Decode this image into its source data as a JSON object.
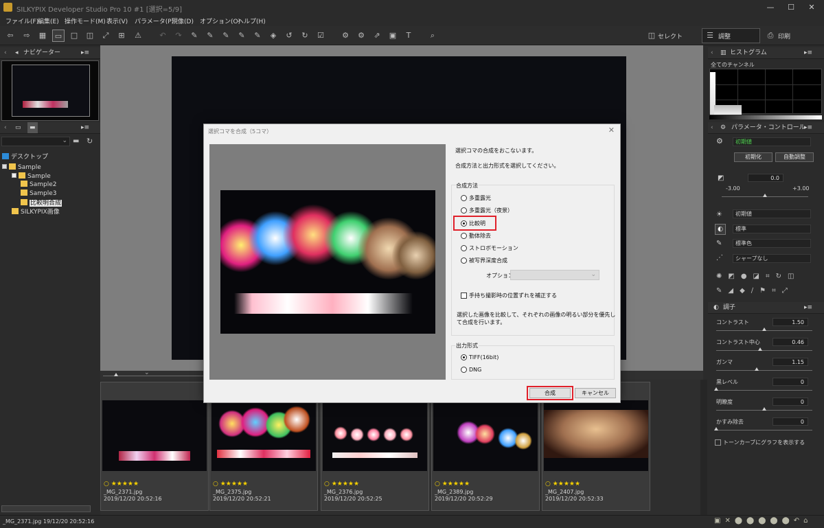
{
  "window": {
    "title": "SILKYPIX Developer Studio Pro 10   #1   [選択=5/9]",
    "minimize": "—",
    "maximize": "☐",
    "close": "✕"
  },
  "menu": [
    "ファイル(F)",
    "編集(E)",
    "操作モード(M)",
    "表示(V)",
    "パラメータ(P)",
    "現像(D)",
    "オプション(O)",
    "ヘルプ(H)"
  ],
  "toolbar": {
    "select_label": "セレクト",
    "adjust_label": "調整",
    "print_label": "印刷"
  },
  "navigator": {
    "title": "ナビゲーター"
  },
  "folder_panel": {
    "tree": [
      {
        "label": "デスクトップ"
      },
      {
        "label": "Sample"
      },
      {
        "label": "Sample"
      },
      {
        "label": "Sample2"
      },
      {
        "label": "Sample3"
      },
      {
        "label": "比較明合成"
      },
      {
        "label": "SILKYPIX画像"
      }
    ]
  },
  "thumbnails": [
    {
      "name": "_MG_2371.jpg",
      "date": "2019/12/20 20:52:16",
      "stars": "○ ★★★★★"
    },
    {
      "name": "_MG_2375.jpg",
      "date": "2019/12/20 20:52:21",
      "stars": "○ ★★★★★"
    },
    {
      "name": "_MG_2376.jpg",
      "date": "2019/12/20 20:52:25",
      "stars": "○ ★★★★★"
    },
    {
      "name": "_MG_2389.jpg",
      "date": "2019/12/20 20:52:29",
      "stars": "○ ★★★★★"
    },
    {
      "name": "_MG_2407.jpg",
      "date": "2019/12/20 20:52:33",
      "stars": "○ ★★★★★"
    }
  ],
  "histogram": {
    "title": "ヒストグラム",
    "channel": "全てのチャンネル"
  },
  "param_control": {
    "title": "パラメータ・コントロール",
    "preset": "初期値",
    "reset_button": "初期化",
    "auto_button": "自動調整",
    "exposure_value": "0.0",
    "exposure_min": "-3.00",
    "exposure_max": "+3.00",
    "wb_select": "初期値",
    "tone_select": "標準",
    "color_select": "標準色",
    "sharp_select": "シャープなし"
  },
  "tone_panel": {
    "title": "調子",
    "rows": [
      {
        "label": "コントラスト",
        "value": "1.50",
        "pos": 0.5
      },
      {
        "label": "コントラスト中心",
        "value": "0.46",
        "pos": 0.46
      },
      {
        "label": "ガンマ",
        "value": "1.15",
        "pos": 0.42
      },
      {
        "label": "黒レベル",
        "value": "0",
        "pos": 0.0
      },
      {
        "label": "明瞭度",
        "value": "0",
        "pos": 0.5
      },
      {
        "label": "かすみ除去",
        "value": "0",
        "pos": 0.0
      }
    ],
    "curve_checkbox": "トーンカーブにグラフを表示する"
  },
  "status": {
    "text": "_MG_2371.jpg 19/12/20 20:52:16"
  },
  "dialog": {
    "title": "選択コマを合成（5コマ）",
    "close": "✕",
    "desc1": "選択コマの合成をおこないます。",
    "desc2": "合成方法と出力形式を選択してください。",
    "method_group": "合成方法",
    "methods": [
      "多重露光",
      "多重露光（夜景）",
      "比較明",
      "動体除去",
      "ストロボモーション",
      "被写界深度合成"
    ],
    "selected_method": "比較明",
    "option_label": "オプション",
    "handheld_label": "手持ち撮影時の位置ずれを補正する",
    "explain1": "選択した画像を比較して、それぞれの画像の明るい部分を優先し",
    "explain2": "て合成を行います。",
    "output_group": "出力形式",
    "outputs": [
      "TIFF(16bit)",
      "DNG"
    ],
    "selected_output": "TIFF(16bit)",
    "ok_button": "合成",
    "cancel_button": "キャンセル"
  },
  "colors": {
    "highlight_red": "#e0202a",
    "star_yellow": "#f5d000",
    "folder_yellow": "#f0c44c"
  }
}
